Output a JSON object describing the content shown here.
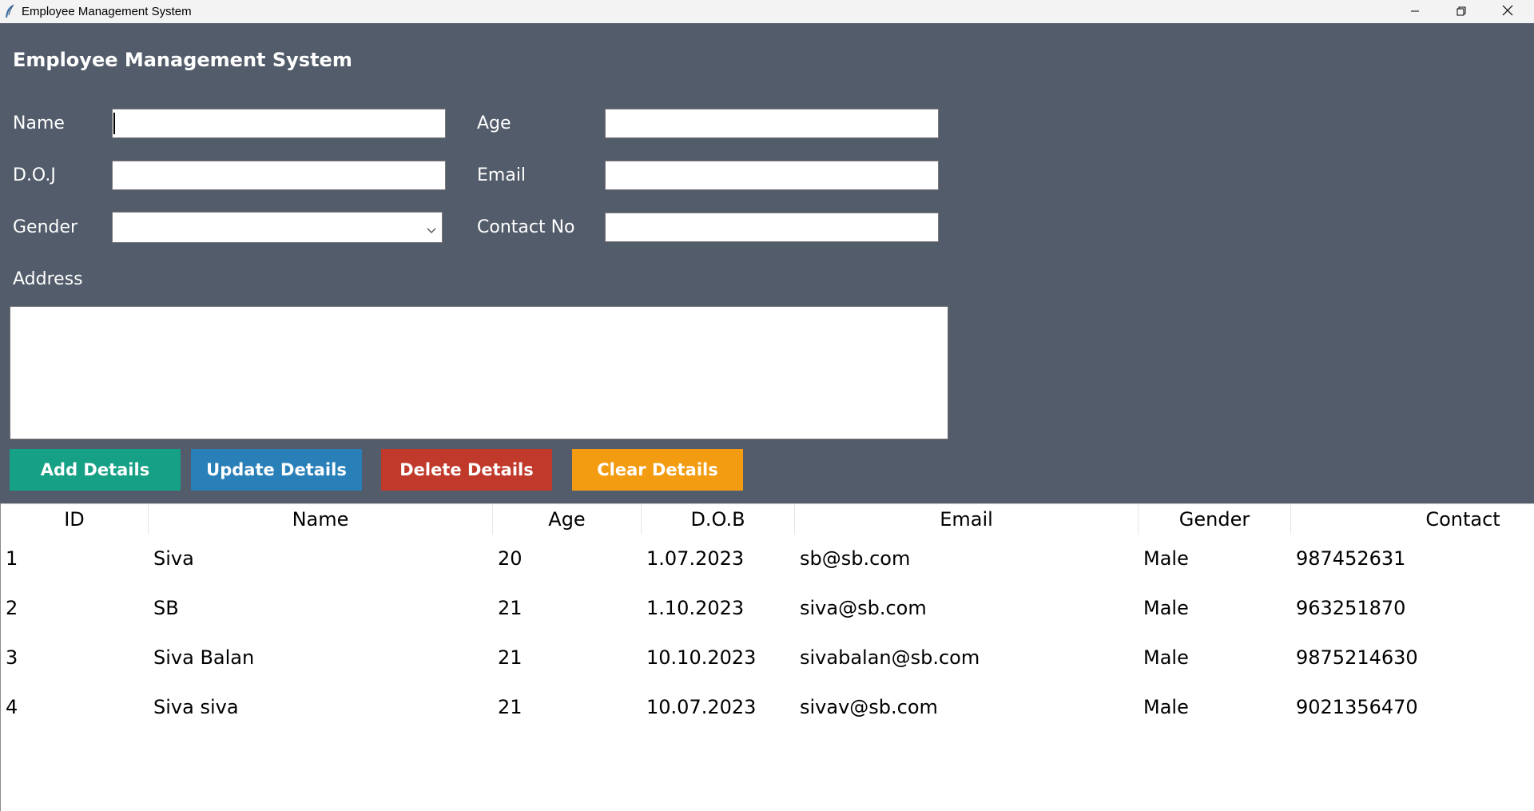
{
  "window": {
    "title": "Employee Management System"
  },
  "form": {
    "title": "Employee Management System",
    "labels": {
      "name": "Name",
      "age": "Age",
      "doj": "D.O.J",
      "email": "Email",
      "gender": "Gender",
      "contact": "Contact No",
      "address": "Address"
    },
    "values": {
      "name": "",
      "age": "",
      "doj": "",
      "email": "",
      "gender": "",
      "contact": "",
      "address": ""
    }
  },
  "buttons": {
    "add": "Add Details",
    "update": "Update Details",
    "delete": "Delete Details",
    "clear": "Clear Details"
  },
  "table": {
    "columns": [
      "ID",
      "Name",
      "Age",
      "D.O.B",
      "Email",
      "Gender",
      "Contact"
    ],
    "rows": [
      [
        "1",
        "Siva",
        "20",
        "1.07.2023",
        "sb@sb.com",
        "Male",
        "987452631"
      ],
      [
        "2",
        "SB",
        "21",
        "1.10.2023",
        "siva@sb.com",
        "Male",
        "963251870"
      ],
      [
        "3",
        "Siva Balan",
        "21",
        "10.10.2023",
        "sivabalan@sb.com",
        "Male",
        "9875214630"
      ],
      [
        "4",
        "Siva siva",
        "21",
        "10.07.2023",
        "sivav@sb.com",
        "Male",
        "9021356470"
      ]
    ]
  },
  "colors": {
    "panel": "#535c6a",
    "add": "#16a085",
    "update": "#2980b9",
    "delete": "#c0392b",
    "clear": "#f39c12"
  },
  "icons": {
    "app": "feather-icon",
    "minimize": "minimize-icon",
    "maximize": "restore-icon",
    "close": "close-icon",
    "dropdown": "chevron-down-icon"
  }
}
